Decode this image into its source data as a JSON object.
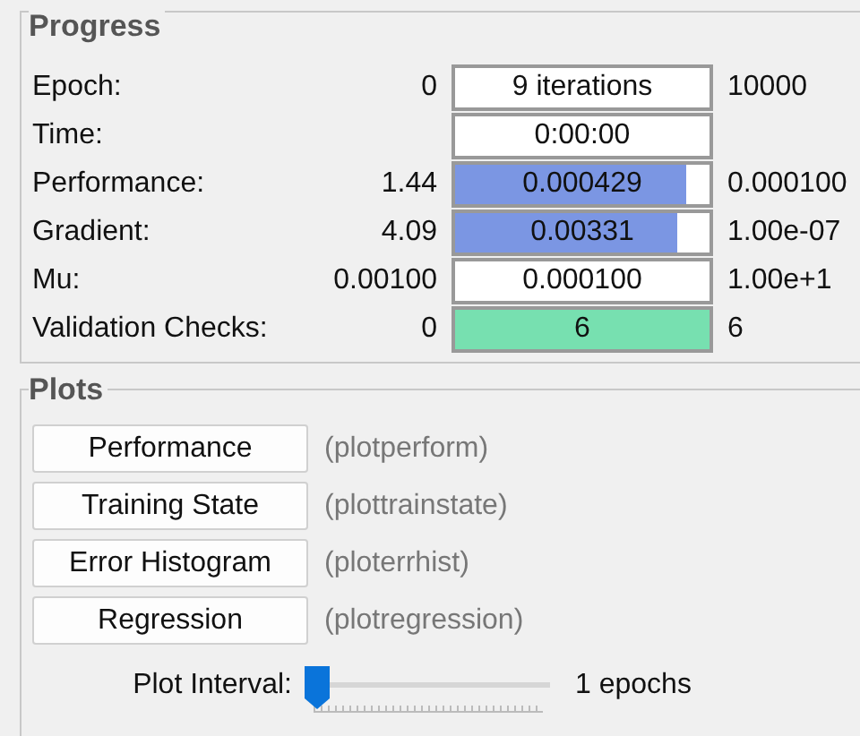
{
  "progress": {
    "title": "Progress",
    "rows": [
      {
        "label": "Epoch:",
        "start": "0",
        "value": "9 iterations",
        "end": "10000"
      },
      {
        "label": "Time:",
        "value": "0:00:00"
      },
      {
        "label": "Performance:",
        "start": "1.44",
        "value": "0.000429",
        "level": 0.91,
        "color": "#7b96e3",
        "end": "0.000100"
      },
      {
        "label": "Gradient:",
        "start": "4.09",
        "value": "0.00331",
        "level": 0.876,
        "color": "#7b96e3",
        "end": "1.00e-07"
      },
      {
        "label": "Mu:",
        "start": "0.00100",
        "value": "0.000100",
        "end": "1.00e+1"
      },
      {
        "label": "Validation Checks:",
        "start": "0",
        "value": "6",
        "level": 1,
        "color": "#77e0b0",
        "end": "6"
      }
    ]
  },
  "plots": {
    "title": "Plots",
    "buttons": [
      {
        "label": "Performance",
        "function": "(plotperform)"
      },
      {
        "label": "Training State",
        "function": "(plottrainstate)"
      },
      {
        "label": "Error Histogram",
        "function": "(ploterrhist)"
      },
      {
        "label": "Regression",
        "function": "(plotregression)"
      }
    ],
    "plot_interval": {
      "label": "Plot Interval:",
      "level": 0,
      "reading": "1 epochs"
    }
  }
}
